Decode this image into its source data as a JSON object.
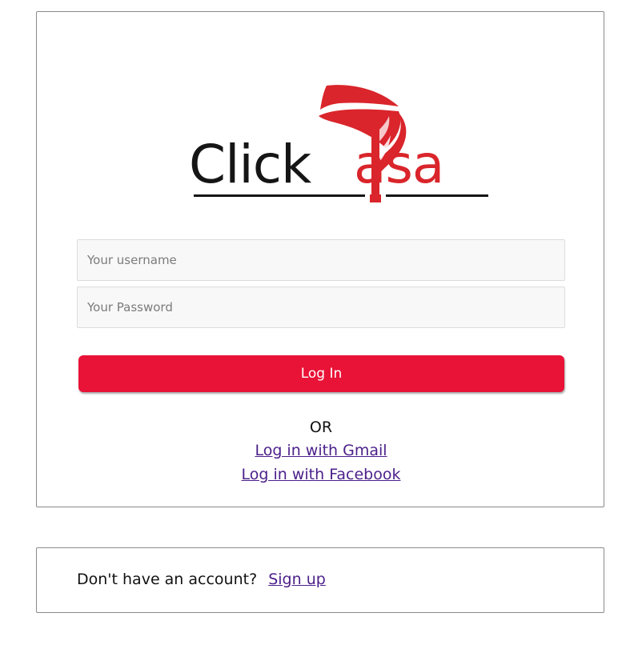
{
  "logo": {
    "text_left": "Click",
    "text_right": "asa",
    "brand_red": "#d9252b",
    "brand_dark": "#151515"
  },
  "form": {
    "username_placeholder": "Your username",
    "password_placeholder": "Your Password",
    "login_label": "Log In",
    "login_color": "#e91237"
  },
  "alternatives": {
    "or_label": "OR",
    "gmail_label": "Log in with Gmail",
    "facebook_label": "Log in with Facebook",
    "link_color": "#4b1f8a"
  },
  "signup": {
    "prompt": "Don't have an account?",
    "link_label": "Sign up"
  }
}
